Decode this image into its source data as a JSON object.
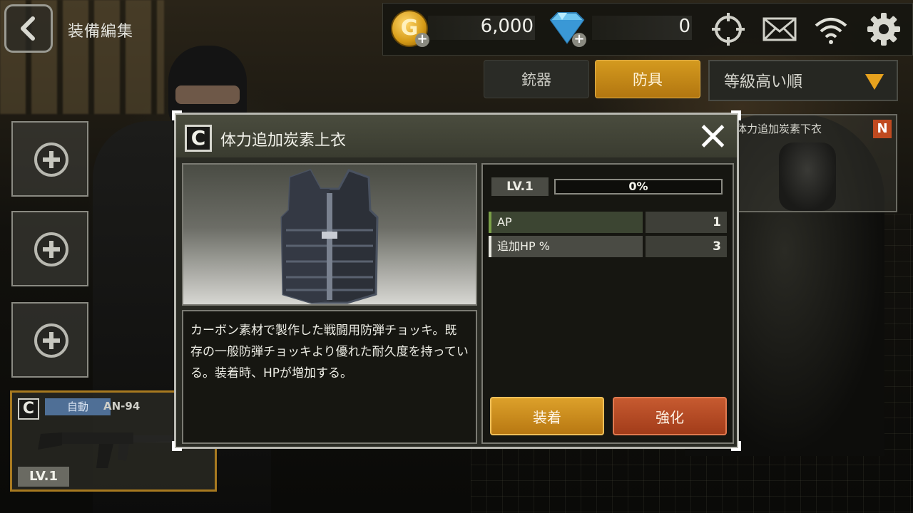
{
  "header": {
    "title": "装備編集",
    "gold": "6,000",
    "gems": "0",
    "gold_icon_letter": "G",
    "icons": [
      "back-arrow-icon",
      "gold-coin-icon",
      "diamond-icon",
      "crosshair-icon",
      "mail-icon",
      "wifi-icon",
      "gear-icon"
    ]
  },
  "tabs": [
    {
      "label": "銃器",
      "active": false
    },
    {
      "label": "防具",
      "active": true
    }
  ],
  "sort": {
    "selected": "等級高い順"
  },
  "list": {
    "card_name": "体力追加炭素下衣",
    "card_rarity": "N"
  },
  "weapon_card": {
    "grade": "C",
    "type": "自動",
    "name": "AN-94",
    "level": "LV.1"
  },
  "modal": {
    "grade": "C",
    "title": "体力追加炭素上衣",
    "description": "カーボン素材で製作した戦闘用防弾チョッキ。既存の一般防弾チョッキより優れた耐久度を持っている。装着時、HPが増加する。",
    "level": "LV.1",
    "exp_percent": 0,
    "exp_label": "0%",
    "stats": [
      {
        "label": "AP",
        "value": "1"
      },
      {
        "label": "追加HP %",
        "value": "3"
      }
    ],
    "equip_label": "装着",
    "upgrade_label": "強化"
  },
  "colors": {
    "accent": "#d49a1f",
    "upgrade": "#b8482a",
    "rarity_n": "#c04a20",
    "weapon_type": "#4f6f96"
  }
}
